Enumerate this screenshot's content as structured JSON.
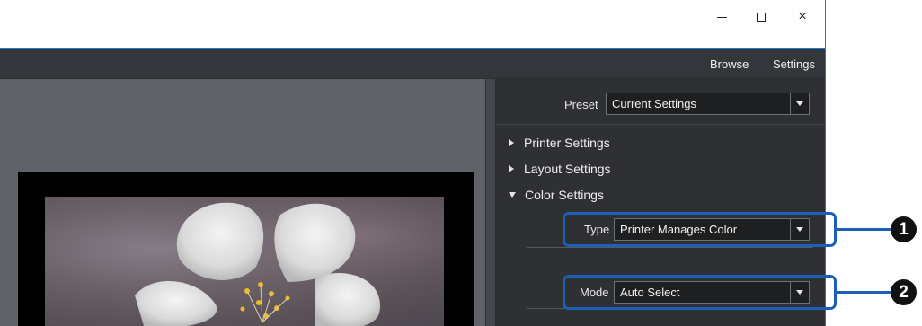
{
  "window": {
    "controls": {
      "minimize": "–",
      "maximize": "□",
      "close": "×"
    }
  },
  "menubar": {
    "items": [
      {
        "label": "Browse"
      },
      {
        "label": "Settings"
      }
    ]
  },
  "panel": {
    "preset": {
      "label": "Preset",
      "value": "Current Settings"
    },
    "sections": [
      {
        "label": "Printer Settings",
        "expanded": false
      },
      {
        "label": "Layout Settings",
        "expanded": false
      },
      {
        "label": "Color Settings",
        "expanded": true
      }
    ],
    "color_settings": {
      "type": {
        "label": "Type",
        "value": "Printer Manages Color"
      },
      "mode": {
        "label": "Mode",
        "value": "Auto Select"
      }
    }
  },
  "callouts": [
    "1",
    "2"
  ],
  "colors": {
    "accent_blue": "#1c5fb4",
    "panel_bg": "#2e3033",
    "preview_bg": "#5f6266"
  }
}
